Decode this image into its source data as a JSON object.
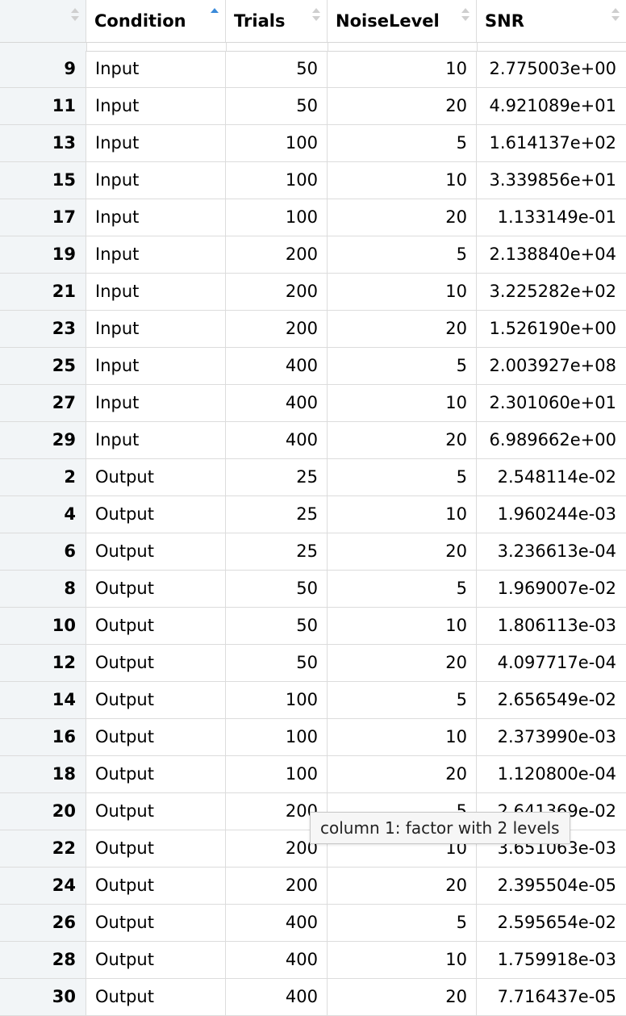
{
  "columns": {
    "index": "",
    "condition": "Condition",
    "trials": "Trials",
    "noise_level": "NoiseLevel",
    "snr": "SNR"
  },
  "sorted_column": "Condition",
  "sort_direction": "ascending",
  "rows": [
    {
      "id": "9",
      "condition": "Input",
      "trials": "50",
      "noise_level": "10",
      "snr": "2.775003e+00"
    },
    {
      "id": "11",
      "condition": "Input",
      "trials": "50",
      "noise_level": "20",
      "snr": "4.921089e+01"
    },
    {
      "id": "13",
      "condition": "Input",
      "trials": "100",
      "noise_level": "5",
      "snr": "1.614137e+02"
    },
    {
      "id": "15",
      "condition": "Input",
      "trials": "100",
      "noise_level": "10",
      "snr": "3.339856e+01"
    },
    {
      "id": "17",
      "condition": "Input",
      "trials": "100",
      "noise_level": "20",
      "snr": "1.133149e-01"
    },
    {
      "id": "19",
      "condition": "Input",
      "trials": "200",
      "noise_level": "5",
      "snr": "2.138840e+04"
    },
    {
      "id": "21",
      "condition": "Input",
      "trials": "200",
      "noise_level": "10",
      "snr": "3.225282e+02"
    },
    {
      "id": "23",
      "condition": "Input",
      "trials": "200",
      "noise_level": "20",
      "snr": "1.526190e+00"
    },
    {
      "id": "25",
      "condition": "Input",
      "trials": "400",
      "noise_level": "5",
      "snr": "2.003927e+08"
    },
    {
      "id": "27",
      "condition": "Input",
      "trials": "400",
      "noise_level": "10",
      "snr": "2.301060e+01"
    },
    {
      "id": "29",
      "condition": "Input",
      "trials": "400",
      "noise_level": "20",
      "snr": "6.989662e+00"
    },
    {
      "id": "2",
      "condition": "Output",
      "trials": "25",
      "noise_level": "5",
      "snr": "2.548114e-02"
    },
    {
      "id": "4",
      "condition": "Output",
      "trials": "25",
      "noise_level": "10",
      "snr": "1.960244e-03"
    },
    {
      "id": "6",
      "condition": "Output",
      "trials": "25",
      "noise_level": "20",
      "snr": "3.236613e-04"
    },
    {
      "id": "8",
      "condition": "Output",
      "trials": "50",
      "noise_level": "5",
      "snr": "1.969007e-02"
    },
    {
      "id": "10",
      "condition": "Output",
      "trials": "50",
      "noise_level": "10",
      "snr": "1.806113e-03"
    },
    {
      "id": "12",
      "condition": "Output",
      "trials": "50",
      "noise_level": "20",
      "snr": "4.097717e-04"
    },
    {
      "id": "14",
      "condition": "Output",
      "trials": "100",
      "noise_level": "5",
      "snr": "2.656549e-02"
    },
    {
      "id": "16",
      "condition": "Output",
      "trials": "100",
      "noise_level": "10",
      "snr": "2.373990e-03"
    },
    {
      "id": "18",
      "condition": "Output",
      "trials": "100",
      "noise_level": "20",
      "snr": "1.120800e-04"
    },
    {
      "id": "20",
      "condition": "Output",
      "trials": "200",
      "noise_level": "5",
      "snr": "2.641369e-02"
    },
    {
      "id": "22",
      "condition": "Output",
      "trials": "200",
      "noise_level": "10",
      "snr": "3.651063e-03"
    },
    {
      "id": "24",
      "condition": "Output",
      "trials": "200",
      "noise_level": "20",
      "snr": "2.395504e-05"
    },
    {
      "id": "26",
      "condition": "Output",
      "trials": "400",
      "noise_level": "5",
      "snr": "2.595654e-02"
    },
    {
      "id": "28",
      "condition": "Output",
      "trials": "400",
      "noise_level": "10",
      "snr": "1.759918e-03"
    },
    {
      "id": "30",
      "condition": "Output",
      "trials": "400",
      "noise_level": "20",
      "snr": "7.716437e-05"
    }
  ],
  "tooltip": "column 1: factor with 2 levels",
  "colors": {
    "sort_active": "#3b8ad9",
    "index_background": "#f2f5f7",
    "grid_lines": "#dcdcdc"
  }
}
